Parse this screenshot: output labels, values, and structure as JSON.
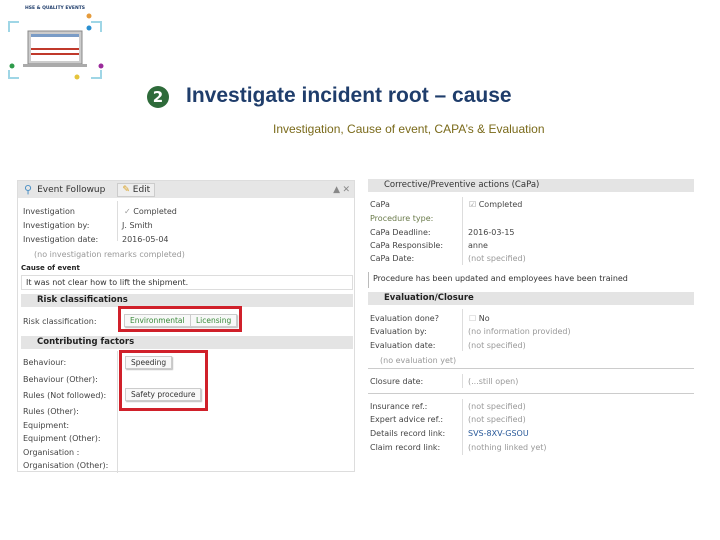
{
  "thumbnail": {
    "caption": "HSE & QUALITY EVENTS"
  },
  "heading": {
    "step": "2",
    "title": "Investigate incident root – cause",
    "subtitle": "Investigation, Cause of event, CAPA’s & Evaluation"
  },
  "left": {
    "title": "Event Followup",
    "edit": "Edit",
    "rows": [
      {
        "label": "Investigation",
        "value": "Completed"
      },
      {
        "label": "Investigation by:",
        "value": "J. Smith"
      },
      {
        "label": "Investigation date:",
        "value": "2016-05-04"
      }
    ],
    "remarks": "(no investigation remarks completed)",
    "cause_label": "Cause of event",
    "cause_text": "It was not clear how to lift the shipment.",
    "risk_header": "Risk classifications",
    "risk_label": "Risk classification:",
    "risk_tags": [
      "Environmental",
      "Licensing"
    ],
    "contrib_header": "Contributing factors",
    "contrib_rows": [
      "Behaviour:",
      "Behaviour (Other):",
      "Rules (Not followed):",
      "Rules (Other):",
      "Equipment:",
      "Equipment (Other):",
      "Organisation :",
      "Organisation (Other):"
    ],
    "contrib_tags": [
      "Speeding",
      "Safety procedure"
    ]
  },
  "right": {
    "capa_header": "Corrective/Preventive actions (CaPa)",
    "capa_rows": [
      {
        "label": "CaPa",
        "value": "Completed"
      },
      {
        "label": "Procedure type:",
        "value": ""
      },
      {
        "label": "CaPa Deadline:",
        "value": "2016-03-15"
      },
      {
        "label": "CaPa Responsible:",
        "value": "anne"
      },
      {
        "label": "CaPa Date:",
        "value": "(not specified)"
      }
    ],
    "capa_text": "Procedure has been updated and employees have been trained",
    "eval_header": "Evaluation/Closure",
    "eval_rows": [
      {
        "label": "Evaluation done?",
        "value": "No"
      },
      {
        "label": "Evaluation by:",
        "value": "(no information provided)"
      },
      {
        "label": "Evaluation date:",
        "value": "(not specified)"
      }
    ],
    "eval_note": "(no evaluation yet)",
    "closure": {
      "label": "Closure date:",
      "value": "(...still open)"
    },
    "ref_rows": [
      {
        "label": "Insurance ref.:",
        "value": "(not specified)"
      },
      {
        "label": "Expert advice ref.:",
        "value": "(not specified)"
      },
      {
        "label": "Details record link:",
        "value": "SVS-8XV-GSOU"
      },
      {
        "label": "Claim record link:",
        "value": "(nothing linked yet)"
      }
    ]
  }
}
